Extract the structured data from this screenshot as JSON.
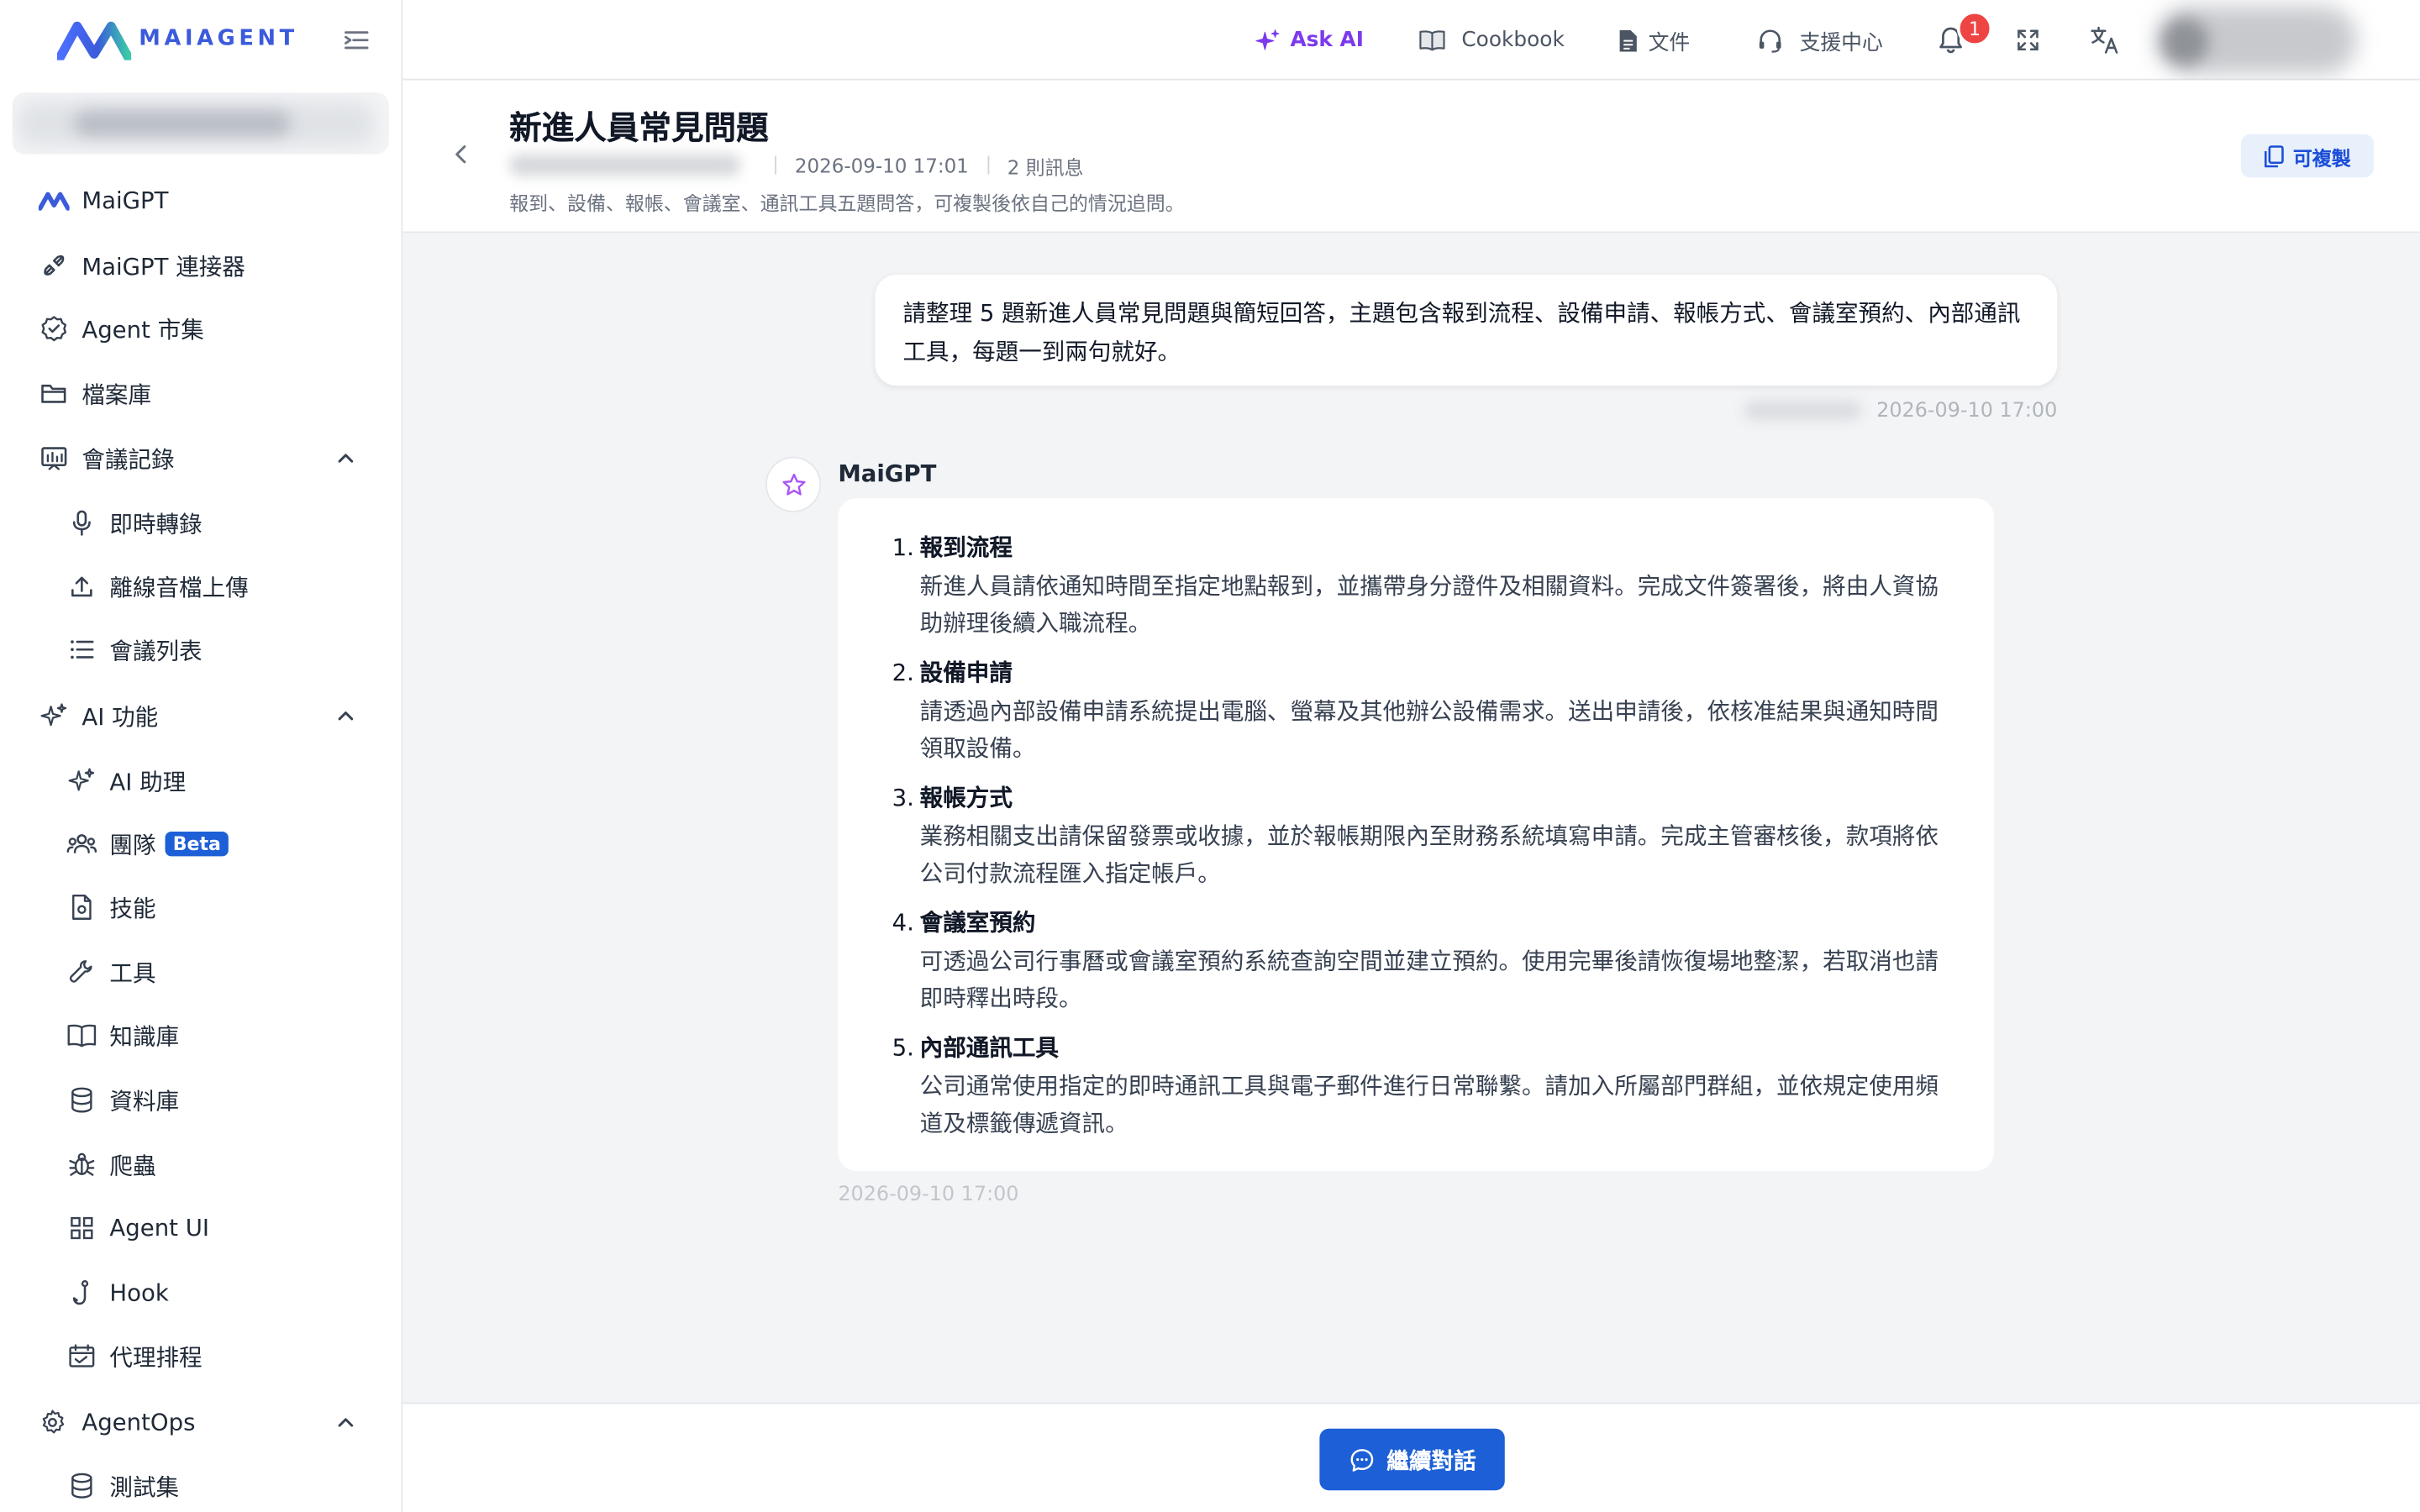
{
  "brand": {
    "name": "MAIAGENT",
    "accent": "#3b5bdb",
    "primary": "#1d5fd6"
  },
  "sidebar": {
    "items": [
      {
        "label": "MaiGPT",
        "icon": "maigpt-logo-icon"
      },
      {
        "label": "MaiGPT 連接器",
        "icon": "connector-icon"
      },
      {
        "label": "Agent 市集",
        "icon": "agent-market-icon"
      },
      {
        "label": "檔案庫",
        "icon": "folder-icon"
      },
      {
        "label": "會議記錄",
        "icon": "meeting-record-icon",
        "expanded": true
      },
      {
        "label": "即時轉錄",
        "icon": "microphone-icon"
      },
      {
        "label": "離線音檔上傳",
        "icon": "upload-icon"
      },
      {
        "label": "會議列表",
        "icon": "list-icon"
      },
      {
        "label": "AI 功能",
        "icon": "sparkles-icon",
        "expanded": true
      },
      {
        "label": "AI 助理",
        "icon": "sparkles-icon"
      },
      {
        "label": "團隊",
        "icon": "team-icon",
        "badge": "Beta"
      },
      {
        "label": "技能",
        "icon": "skill-file-icon"
      },
      {
        "label": "工具",
        "icon": "wrench-icon"
      },
      {
        "label": "知識庫",
        "icon": "book-icon"
      },
      {
        "label": "資料庫",
        "icon": "database-icon"
      },
      {
        "label": "爬蟲",
        "icon": "bug-icon"
      },
      {
        "label": "Agent UI",
        "icon": "grid-icon"
      },
      {
        "label": "Hook",
        "icon": "hook-icon"
      },
      {
        "label": "代理排程",
        "icon": "schedule-icon"
      },
      {
        "label": "AgentOps",
        "icon": "agentops-gear-icon",
        "expanded": true
      },
      {
        "label": "測試集",
        "icon": "database-icon"
      }
    ]
  },
  "topbar": {
    "ask_ai": "Ask AI",
    "cookbook": "Cookbook",
    "docs": "文件",
    "support": "支援中心",
    "notification_count": "1"
  },
  "conversation": {
    "title": "新進人員常見問題",
    "date": "2026-09-10 17:01",
    "message_count": "2 則訊息",
    "description": "報到、設備、報帳、會議室、通訊工具五題問答，可複製後依自己的情況追問。",
    "copy_label": "可複製"
  },
  "messages": {
    "user": {
      "text": "請整理 5 題新進人員常見問題與簡短回答，主題包含報到流程、設備申請、報帳方式、會議室預約、內部通訊工具，每題一到兩句就好。",
      "time": "2026-09-10 17:00"
    },
    "ai": {
      "name": "MaiGPT",
      "time": "2026-09-10 17:00",
      "items": [
        {
          "num": "1.",
          "title": "報到流程",
          "body": "新進人員請依通知時間至指定地點報到，並攜帶身分證件及相關資料。完成文件簽署後，將由人資協助辦理後續入職流程。"
        },
        {
          "num": "2.",
          "title": "設備申請",
          "body": "請透過內部設備申請系統提出電腦、螢幕及其他辦公設備需求。送出申請後，依核准結果與通知時間領取設備。"
        },
        {
          "num": "3.",
          "title": "報帳方式",
          "body": "業務相關支出請保留發票或收據，並於報帳期限內至財務系統填寫申請。完成主管審核後，款項將依公司付款流程匯入指定帳戶。"
        },
        {
          "num": "4.",
          "title": "會議室預約",
          "body": "可透過公司行事曆或會議室預約系統查詢空間並建立預約。使用完畢後請恢復場地整潔，若取消也請即時釋出時段。"
        },
        {
          "num": "5.",
          "title": "內部通訊工具",
          "body": "公司通常使用指定的即時通訊工具與電子郵件進行日常聯繫。請加入所屬部門群組，並依規定使用頻道及標籤傳遞資訊。"
        }
      ]
    }
  },
  "footer": {
    "continue_label": "繼續對話"
  }
}
